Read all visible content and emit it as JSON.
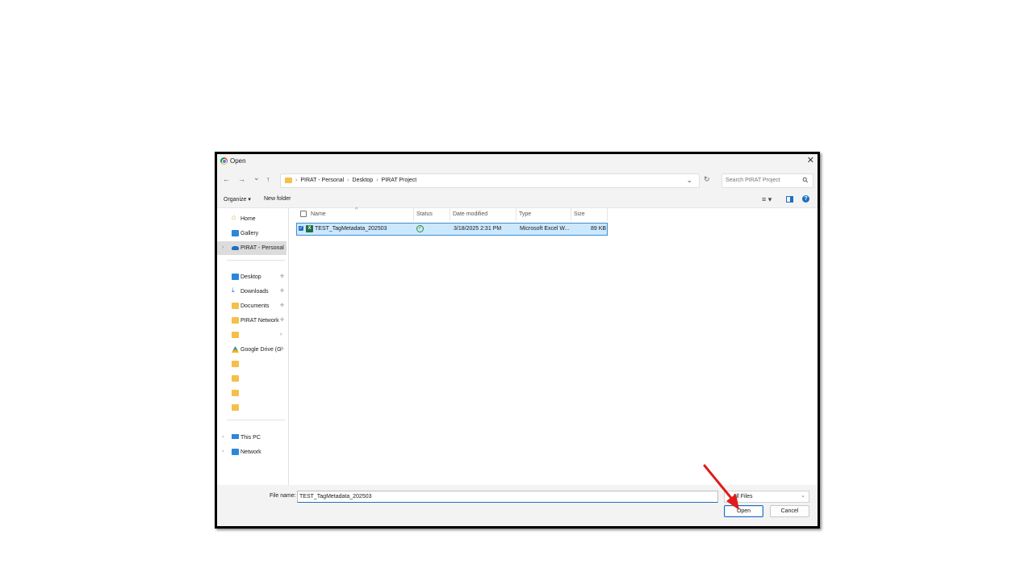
{
  "window": {
    "title": "Open",
    "close": "✕"
  },
  "nav": {
    "back": "←",
    "forward": "→",
    "recent": "⌄",
    "up": "↑",
    "breadcrumb": [
      "PIRAT - Personal",
      "Desktop",
      "PIRAT Project"
    ],
    "sep": "›",
    "dropdown": "⌄",
    "refresh": "↻",
    "search_placeholder": "Search PIRAT Project"
  },
  "toolbar": {
    "organize": "Organize ▾",
    "new_folder": "New folder",
    "view": "≡ ▾",
    "help": "?"
  },
  "sidebar": {
    "quick": [
      {
        "label": "Home",
        "icon": "home-icon"
      },
      {
        "label": "Gallery",
        "icon": "gallery-icon"
      },
      {
        "label": "PIRAT - Personal",
        "icon": "cloud-icon",
        "selected": true,
        "chevron": "›"
      }
    ],
    "pinned": [
      {
        "label": "Desktop",
        "icon": "desktop-folder-icon",
        "pin": "📌"
      },
      {
        "label": "Downloads",
        "icon": "download-icon",
        "pin": "📌"
      },
      {
        "label": "Documents",
        "icon": "folder-icon",
        "pin": "📌"
      },
      {
        "label": "PIRAT Network",
        "icon": "folder-icon",
        "pin": "📌"
      },
      {
        "label": "",
        "icon": "folder-icon",
        "pin": "›"
      },
      {
        "label": "Google Drive (G",
        "icon": "google-drive-icon",
        "pin": "📌"
      },
      {
        "label": "",
        "icon": "folder-icon"
      },
      {
        "label": "",
        "icon": "folder-icon"
      },
      {
        "label": "",
        "icon": "folder-icon"
      },
      {
        "label": "",
        "icon": "folder-icon"
      }
    ],
    "devices": [
      {
        "label": "This PC",
        "icon": "pc-icon",
        "chevron": "›"
      },
      {
        "label": "Network",
        "icon": "network-icon",
        "chevron": "›"
      }
    ]
  },
  "columns": {
    "name": "Name",
    "status": "Status",
    "date": "Date modified",
    "type": "Type",
    "size": "Size",
    "sort": "^"
  },
  "files": [
    {
      "name": "TEST_TagMetadata_202503",
      "status": "✓",
      "date": "3/18/2025 2:31 PM",
      "type": "Microsoft Excel W...",
      "size": "89 KB",
      "icon_text": "X"
    }
  ],
  "footer": {
    "file_name_label": "File name:",
    "file_name_value": "TEST_TagMetadata_202503",
    "file_type": "All Files",
    "file_type_dd": "⌄",
    "open": "Open",
    "cancel": "Cancel"
  },
  "annotation": {
    "arrow_color": "#e11b1b"
  }
}
